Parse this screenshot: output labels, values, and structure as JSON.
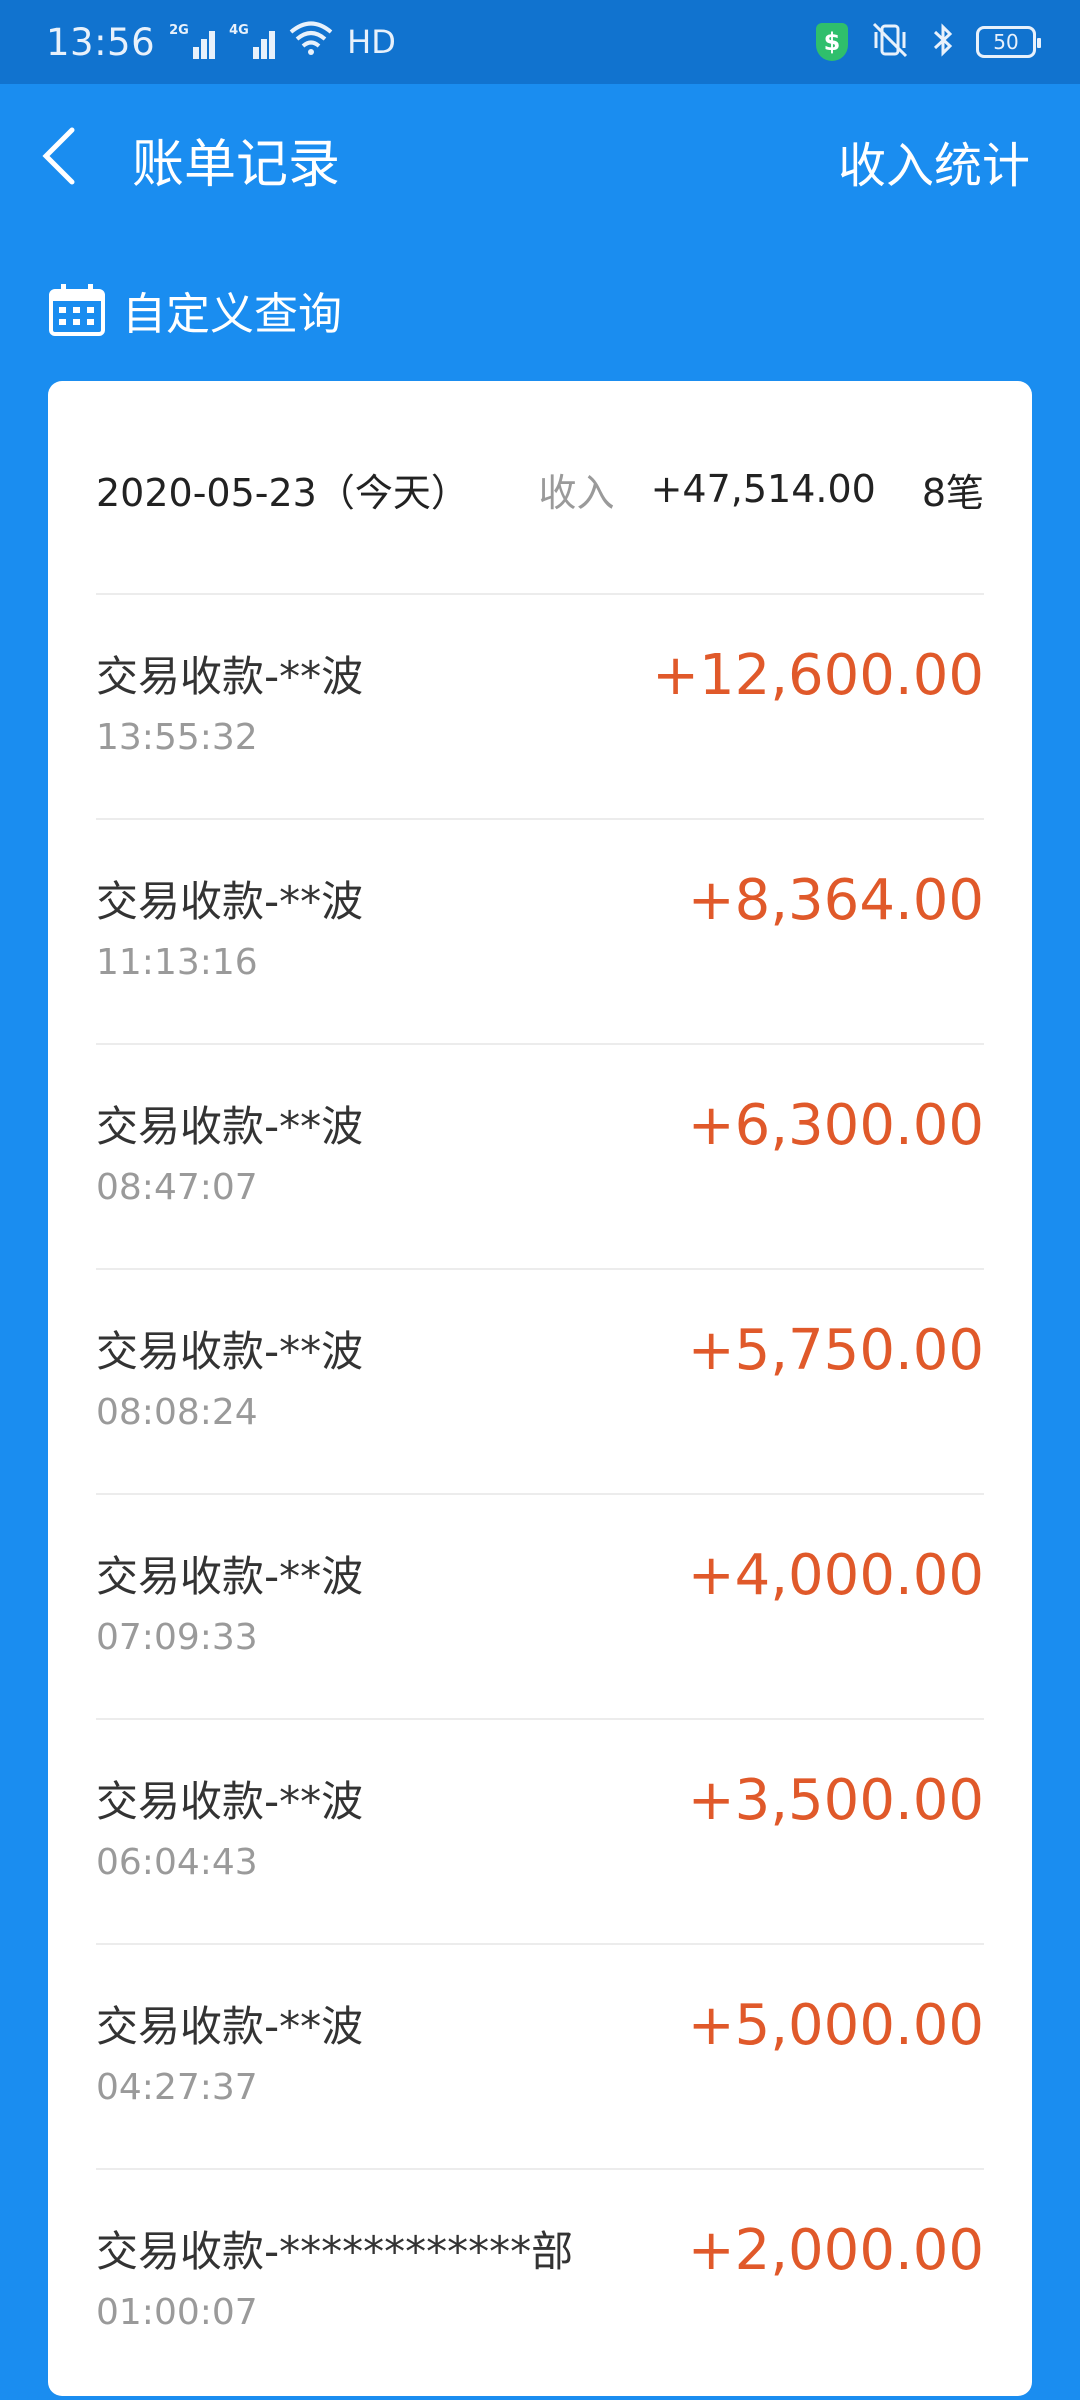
{
  "status_bar": {
    "time": "13:56",
    "signal1_label": "2G",
    "signal2_label": "4G",
    "hd_label": "HD",
    "battery": "50",
    "shield_symbol": "$"
  },
  "nav": {
    "title": "账单记录",
    "right_action": "收入统计"
  },
  "query": {
    "label": "自定义查询"
  },
  "summary": {
    "date": "2020-05-23（今天）",
    "income_label": "收入",
    "amount": "+47,514.00",
    "count": "8笔"
  },
  "transactions": [
    {
      "name": "交易收款-**波",
      "time": "13:55:32",
      "amount": "+12,600.00"
    },
    {
      "name": "交易收款-**波",
      "time": "11:13:16",
      "amount": "+8,364.00"
    },
    {
      "name": "交易收款-**波",
      "time": "08:47:07",
      "amount": "+6,300.00"
    },
    {
      "name": "交易收款-**波",
      "time": "08:08:24",
      "amount": "+5,750.00"
    },
    {
      "name": "交易收款-**波",
      "time": "07:09:33",
      "amount": "+4,000.00"
    },
    {
      "name": "交易收款-**波",
      "time": "06:04:43",
      "amount": "+3,500.00"
    },
    {
      "name": "交易收款-**波",
      "time": "04:27:37",
      "amount": "+5,000.00"
    },
    {
      "name": "交易收款-************部",
      "time": "01:00:07",
      "amount": "+2,000.00"
    }
  ],
  "colors": {
    "header_blue": "#1a8df0",
    "status_blue": "#1173cf",
    "amount_orange": "#e0592a"
  }
}
